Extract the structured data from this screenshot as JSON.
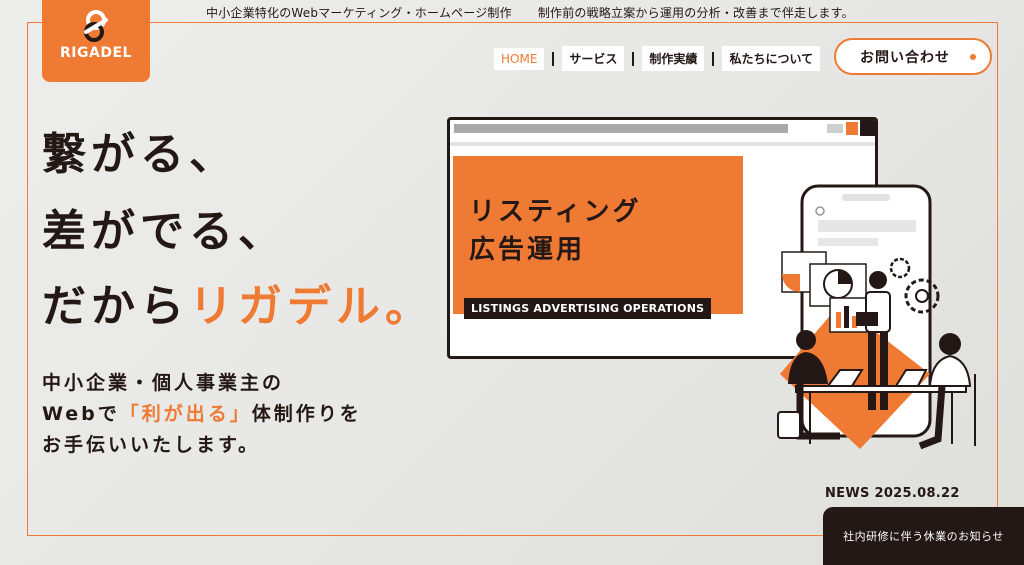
{
  "brand": {
    "name": "RIGADEL",
    "color_orange": "#ef7a33",
    "color_dark": "#231815"
  },
  "tagline": {
    "left": "中小企業特化のWebマーケティング・ホームページ制作",
    "right": "制作前の戦略立案から運用の分析・改善まで伴走します。"
  },
  "nav": {
    "items": [
      {
        "label": "HOME",
        "active": true
      },
      {
        "label": "サービス"
      },
      {
        "label": "制作実績"
      },
      {
        "label": "私たちについて"
      }
    ],
    "contact_label": "お問い合わせ"
  },
  "hero": {
    "line1": "繋がる、",
    "line2": "差がでる、",
    "line3_prefix": "だから",
    "line3_accent": "リガデル。",
    "sub1": "中小企業・個人事業主の",
    "sub2_prefix": "Webで",
    "sub2_accent": "「利が出る」",
    "sub2_suffix": "体制作りを",
    "sub3": "お手伝いいたします。"
  },
  "slide": {
    "title1": "リスティング",
    "title2": "広告運用",
    "badge": "LISTINGS ADVERTISING OPERATIONS"
  },
  "news": {
    "date_label": "NEWS 2025.08.22",
    "headline": "社内研修に伴う休業のお知らせ"
  }
}
